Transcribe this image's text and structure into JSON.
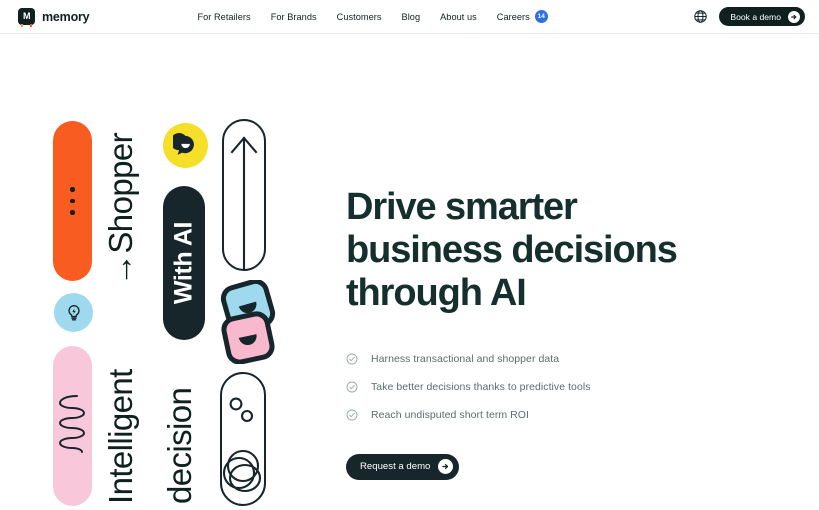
{
  "header": {
    "logo_glyph": "M",
    "brand_name": "memory",
    "nav": [
      {
        "label": "For Retailers",
        "name": "nav-for-retailers"
      },
      {
        "label": "For Brands",
        "name": "nav-for-brands"
      },
      {
        "label": "Customers",
        "name": "nav-customers"
      },
      {
        "label": "Blog",
        "name": "nav-blog"
      },
      {
        "label": "About us",
        "name": "nav-about-us"
      },
      {
        "label": "Careers",
        "name": "nav-careers",
        "badge": "14"
      }
    ],
    "careers_badge": "14",
    "language_icon": "globe-icon",
    "cta_label": "Book a demo",
    "cta_icon": "arrow-right-circle-icon"
  },
  "hero": {
    "headline_line1": "Drive smarter",
    "headline_line2": "business decisions",
    "headline_line3": "through AI",
    "bullets": [
      "Harness transactional and shopper data",
      "Take better decisions thanks to predictive tools",
      "Reach undisputed short term ROI"
    ],
    "cta_label": "Request a demo",
    "cta_icon": "arrow-right-circle-icon"
  },
  "artwork": {
    "word_shopper": "→Shopper",
    "word_intelligent": "Intelligent",
    "word_decision": "decision",
    "label_with_ai": "With AI",
    "icons": {
      "orange_pill": "three-dots-icon",
      "yellow_circle": "speech-bubble-icon",
      "blue_circle": "lightbulb-icon",
      "pink_pill": "spring-coil-icon",
      "outline_pill_top": "up-arrow-icon",
      "outline_pill_bottom": "circles-icon",
      "squares": "stacked-cards-icon"
    }
  },
  "colors": {
    "orange": "#F95C20",
    "yellow": "#F5DF28",
    "pink": "#F8C8DA",
    "light_blue": "#9ED9EE",
    "dark": "#16262A",
    "headline": "#15302C",
    "badge_blue": "#2F6FE4",
    "body_text": "#5E6B6B"
  }
}
